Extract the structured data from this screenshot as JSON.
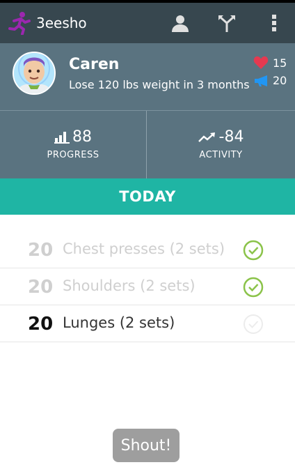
{
  "app": {
    "title": "3eesho",
    "logo_icon": "runner-logo-icon",
    "colors": {
      "appbar": "#37474f",
      "profile": "#5a7380",
      "accent": "#1fb5a4",
      "check": "#8bc34a",
      "logo": "#9c27b0"
    }
  },
  "toolbar": {
    "profile_icon": "person-icon",
    "share_icon": "merge-icon",
    "menu_icon": "overflow-menu-icon"
  },
  "profile": {
    "name": "Caren",
    "goal": "Lose 120 lbs weight in 3 months",
    "likes": "15",
    "shouts": "20"
  },
  "stats": {
    "progress": {
      "value": "88",
      "label": "PROGRESS"
    },
    "activity": {
      "value": "-84",
      "label": "ACTIVITY"
    }
  },
  "today": {
    "label": "TODAY"
  },
  "tasks": [
    {
      "count": "20",
      "name": "Chest presses (2 sets)",
      "done": true
    },
    {
      "count": "20",
      "name": "Shoulders (2 sets)",
      "done": true
    },
    {
      "count": "20",
      "name": "Lunges (2 sets)",
      "done": false
    }
  ],
  "shout": {
    "label": "Shout!"
  }
}
